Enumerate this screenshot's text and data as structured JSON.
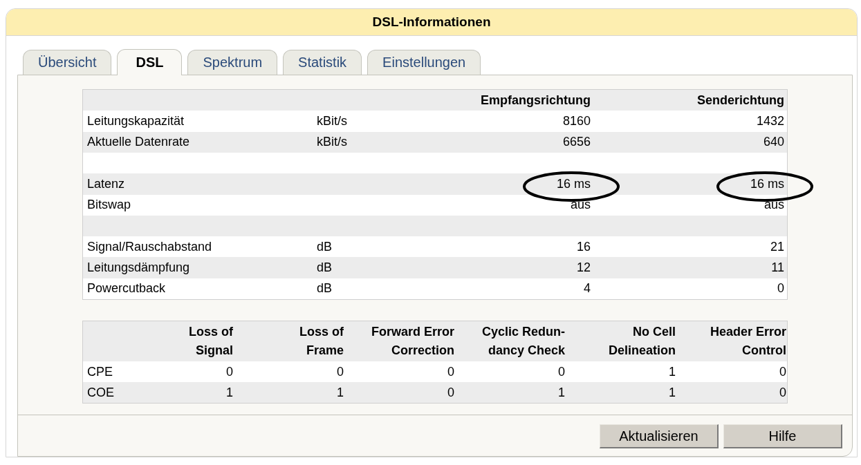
{
  "window": {
    "title": "DSL-Informationen"
  },
  "tabs": [
    {
      "label": "Übersicht",
      "selected": false
    },
    {
      "label": "DSL",
      "selected": true
    },
    {
      "label": "Spektrum",
      "selected": false
    },
    {
      "label": "Statistik",
      "selected": false
    },
    {
      "label": "Einstellungen",
      "selected": false
    }
  ],
  "line_table": {
    "columns": [
      "Empfangsrichtung",
      "Senderichtung"
    ],
    "rows": [
      {
        "kind": "data",
        "label": "Leitungskapazität",
        "unit": "kBit/s",
        "values": [
          "8160",
          "1432"
        ],
        "circled": false
      },
      {
        "kind": "data",
        "label": "Aktuelle Datenrate",
        "unit": "kBit/s",
        "values": [
          "6656",
          "640"
        ],
        "circled": false
      },
      {
        "kind": "spacer"
      },
      {
        "kind": "data",
        "label": "Latenz",
        "values": [
          "16 ms",
          "16 ms"
        ],
        "circled": true
      },
      {
        "kind": "data",
        "label": "Bitswap",
        "values": [
          "aus",
          "aus"
        ],
        "circled": false
      },
      {
        "kind": "spacer"
      },
      {
        "kind": "data",
        "label": "Signal/Rauschabstand",
        "unit": "dB",
        "values": [
          "16",
          "21"
        ],
        "circled": false
      },
      {
        "kind": "data",
        "label": "Leitungsdämpfung",
        "unit": "dB",
        "values": [
          "12",
          "11"
        ],
        "circled": false
      },
      {
        "kind": "data",
        "label": "Powercutback",
        "unit": "dB",
        "values": [
          "4",
          "0"
        ],
        "circled": false
      }
    ]
  },
  "error_table": {
    "columns": [
      [
        "Loss of",
        "Signal"
      ],
      [
        "Loss of",
        "Frame"
      ],
      [
        "Forward Error",
        "Correction"
      ],
      [
        "Cyclic Redun-",
        "dancy Check"
      ],
      [
        "No Cell",
        "Delineation"
      ],
      [
        "Header Error",
        "Control"
      ]
    ],
    "rows": [
      {
        "label": "CPE",
        "values": [
          "0",
          "0",
          "0",
          "0",
          "1",
          "0"
        ]
      },
      {
        "label": "COE",
        "values": [
          "1",
          "1",
          "0",
          "1",
          "1",
          "0"
        ]
      }
    ]
  },
  "buttons": [
    "Aktualisieren",
    "Hilfe"
  ]
}
